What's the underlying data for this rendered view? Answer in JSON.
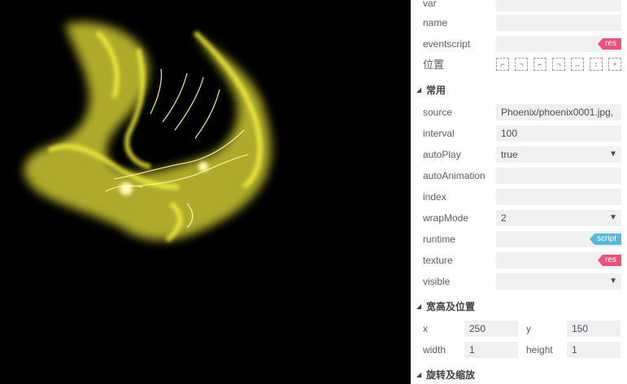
{
  "preview": {
    "colors": {
      "background": "#000000",
      "flame": "#f2f03a",
      "core": "#fffbb0"
    }
  },
  "props": {
    "top_rows": [
      {
        "label": "var",
        "value": ""
      },
      {
        "label": "name",
        "value": ""
      },
      {
        "label": "eventscript",
        "value": "",
        "tag": "res"
      }
    ],
    "position_label": "位置",
    "position_icons": [
      "align-left-icon",
      "align-center-h-icon",
      "align-right-icon",
      "align-top-icon",
      "distribute-h-icon",
      "distribute-v-icon",
      "add-icon"
    ],
    "sections": {
      "common": "常用",
      "size_position": "宽高及位置",
      "rotate_scale": "旋转及缩放"
    },
    "common_rows": [
      {
        "label": "source",
        "value": "Phoenix/phoenix0001.jpg,"
      },
      {
        "label": "interval",
        "value": "100"
      },
      {
        "label": "autoPlay",
        "value": "true",
        "dropdown": true
      },
      {
        "label": "autoAnimation",
        "value": ""
      },
      {
        "label": "index",
        "value": ""
      },
      {
        "label": "wrapMode",
        "value": "2",
        "dropdown": true
      },
      {
        "label": "runtime",
        "value": "",
        "tag": "script"
      },
      {
        "label": "texture",
        "value": "",
        "tag": "res"
      },
      {
        "label": "visible",
        "value": "",
        "dropdown": true
      }
    ],
    "geometry": {
      "x_label": "x",
      "x_value": "250",
      "y_label": "y",
      "y_value": "150",
      "width_label": "width",
      "width_value": "1",
      "height_label": "height",
      "height_value": "1"
    },
    "colors": {
      "res_tag": "#e8537b",
      "script_tag": "#5ab9d6",
      "field_bg": "#eef0f2"
    }
  }
}
